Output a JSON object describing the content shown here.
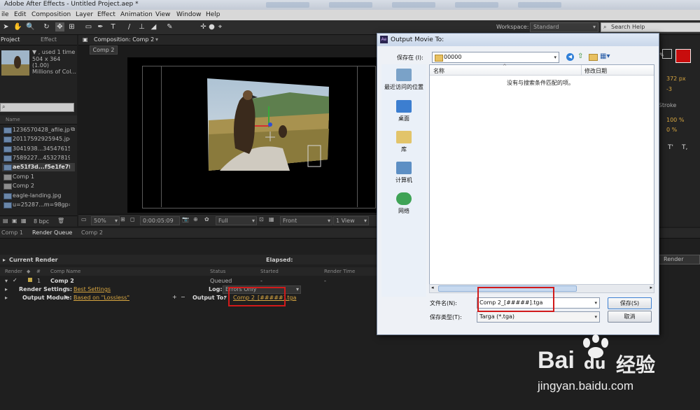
{
  "window": {
    "title": "Adobe After Effects - Untitled Project.aep *"
  },
  "menu": [
    "ile",
    "Edit",
    "Composition",
    "Layer",
    "Effect",
    "Animation",
    "View",
    "Window",
    "Help"
  ],
  "toolbar": {
    "workspace_label": "Workspace:",
    "workspace_value": "Standard",
    "search_placeholder": "Search Help"
  },
  "project_panel": {
    "tabs": [
      "Project",
      "Effect"
    ],
    "preview_info": [
      "▼ , used 1 time",
      "504 x 364 (1.00)",
      "Millions of Col..."
    ],
    "search_placeholder": "",
    "column": "Name",
    "items": [
      "1236570428_afile.jpg",
      "20117592925945.jpg",
      "3041938...345476151_",
      "7589227...453278195_",
      "ae51f3d...f5e1fe7f6",
      "Comp 1",
      "Comp 2",
      "eagle-landing.jpg",
      "u=25287...m=98gp="
    ],
    "bpc": "8 bpc"
  },
  "composition": {
    "tab_label": "Composition: Comp 2",
    "comp_tab": "Comp 2",
    "zoom": "50%",
    "timecode": "0:00:05:09",
    "resolution": "Full",
    "view": "Front",
    "views": "1 View"
  },
  "right_panel": {
    "value1": "372 px",
    "value2": "-3",
    "stroke_label": "er Stroke",
    "pct1": "100 %",
    "pct2": "0 %"
  },
  "render_queue": {
    "tabs": [
      "Comp 1",
      "Render Queue",
      "Comp 2"
    ],
    "current_render": "Current Render",
    "elapsed": "Elapsed:",
    "render_button": "Render",
    "columns": [
      "Render",
      "#",
      "Comp Name",
      "Status",
      "Started",
      "Render Time"
    ],
    "row": {
      "number": "1",
      "comp_name": "Comp 2",
      "status": "Queued",
      "started": "-",
      "render_time": "-"
    },
    "render_settings_label": "Render Settings:",
    "render_settings_value": "Best Settings",
    "log_label": "Log:",
    "log_value": "Errors Only",
    "output_module_label": "Output Module:",
    "output_module_value": "Based on \"Lossless\"",
    "output_to_label": "Output To:",
    "output_to_value": "Comp 2_[#####].tga"
  },
  "dialog": {
    "title": "Output Movie To:",
    "save_in_label": "保存在 (I):",
    "save_in_value": "00000",
    "places": [
      "最近访问的位置",
      "桌面",
      "库",
      "计算机",
      "网络"
    ],
    "col_name": "名称",
    "col_date": "修改日期",
    "empty_message": "没有与搜索条件匹配的项。",
    "filename_label": "文件名(N):",
    "filename_value": "Comp 2_[#####].tga",
    "filetype_label": "保存类型(T):",
    "filetype_value": "Targa (*.tga)",
    "save_button": "保存(S)",
    "cancel_button": "取消"
  },
  "watermark": {
    "brand": "Bai",
    "brand_cn": "经验",
    "url": "jingyan.baidu.com"
  },
  "colors": {
    "accent": "#d8a640",
    "highlight_box": "#d11a1a",
    "fill_swatch": "#c80d0d"
  }
}
